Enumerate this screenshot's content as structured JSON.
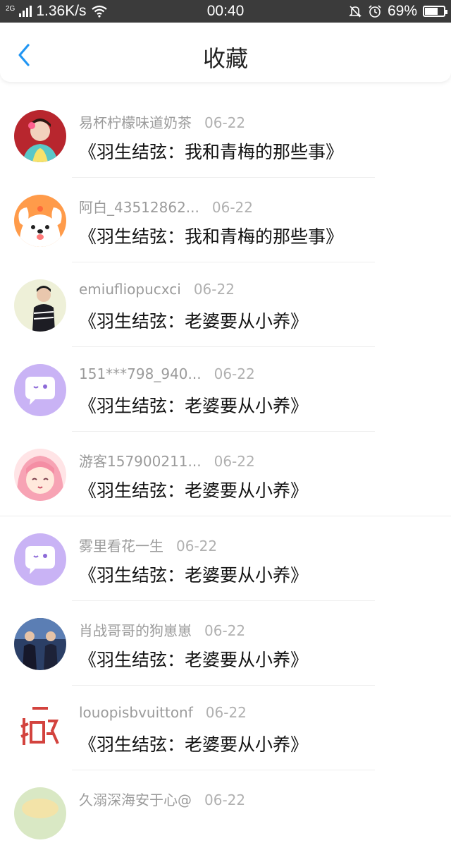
{
  "status_bar": {
    "network": "2G",
    "speed": "1.36K/s",
    "time": "00:40",
    "battery": "69%",
    "battery_level": 0.69
  },
  "header": {
    "title": "收藏",
    "accent_color": "#2196F3"
  },
  "favorites": [
    {
      "user": "易杯柠檬味道奶茶",
      "date": "06-22",
      "book": "《羽生结弦：我和青梅的那些事》",
      "avatar": "photo-avatar-red"
    },
    {
      "user": "阿白_43512862...",
      "date": "06-22",
      "book": "《羽生结弦：我和青梅的那些事》",
      "avatar": "cartoon-dog-avatar"
    },
    {
      "user": "emiufliopucxci",
      "date": "06-22",
      "book": "《羽生结弦：老婆要从小养》",
      "avatar": "photo-avatar-person"
    },
    {
      "user": "151***798_940...",
      "date": "06-22",
      "book": "《羽生结弦：老婆要从小养》",
      "avatar": "default-chat-avatar"
    },
    {
      "user": "游客157900211...",
      "date": "06-22",
      "book": "《羽生结弦：老婆要从小养》",
      "avatar": "anime-girl-avatar"
    },
    {
      "user": "雾里看花一生",
      "date": "06-22",
      "book": "《羽生结弦：老婆要从小养》",
      "avatar": "default-chat-avatar"
    },
    {
      "user": "肖战哥哥的狗崽崽",
      "date": "06-22",
      "book": "《羽生结弦：老婆要从小养》",
      "avatar": "photo-avatar-stage"
    },
    {
      "user": "louopisbvuittonf",
      "date": "06-22",
      "book": "《羽生结弦：老婆要从小养》",
      "avatar": "text-logo-avatar"
    },
    {
      "user": "久溺深海安于心@",
      "date": "06-22",
      "book": "",
      "avatar": "photo-avatar-partial"
    }
  ]
}
